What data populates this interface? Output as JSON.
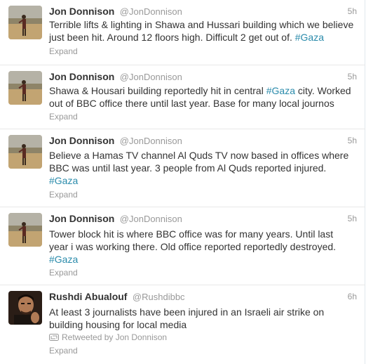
{
  "tweets": [
    {
      "name": "Jon Donnison",
      "handle": "@JonDonnison",
      "time": "5h",
      "line1": "Terrible lifts & lighting in Shawa and Hussari building which we believe",
      "line2": "just been hit. Around 12 floors high. Difficult 2 get out of.",
      "hashtag": "#Gaza",
      "expand": "Expand"
    },
    {
      "name": "Jon Donnison",
      "handle": "@JonDonnison",
      "time": "5h",
      "line1a": "Shawa & Housari building reportedly hit in central",
      "hashtag": "#Gaza",
      "line1b": "city. Worked",
      "line2": "out of BBC office there until last year. Base for many local journos",
      "expand": "Expand"
    },
    {
      "name": "Jon Donnison",
      "handle": "@JonDonnison",
      "time": "5h",
      "line1": "Believe a Hamas TV channel Al Quds TV now based in offices where",
      "line2": "BBC was until last year. 3 people from Al Quds reported injured.",
      "hashtag": "#Gaza",
      "expand": "Expand"
    },
    {
      "name": "Jon Donnison",
      "handle": "@JonDonnison",
      "time": "5h",
      "line1": "Tower block hit is where BBC office was for many years. Until last",
      "line2": "year i was working there. Old office reported reportedly destroyed.",
      "hashtag": "#Gaza",
      "expand": "Expand"
    },
    {
      "name": "Rushdi Abualouf",
      "handle": "@Rushdibbc",
      "time": "6h",
      "line1": "At least 3 journalists have been injured in an Israeli air strike on",
      "line2": "building housing for local media",
      "retweeted": "Retweeted by Jon Donnison",
      "expand": "Expand"
    }
  ],
  "colors": {
    "hashtag": "#2a8bab",
    "name": "#333333",
    "meta": "#999999"
  },
  "icons": {
    "avatar_jon": "person-on-beach-photo",
    "avatar_rushdi": "man-portrait-photo",
    "retweet": "retweet-icon"
  }
}
